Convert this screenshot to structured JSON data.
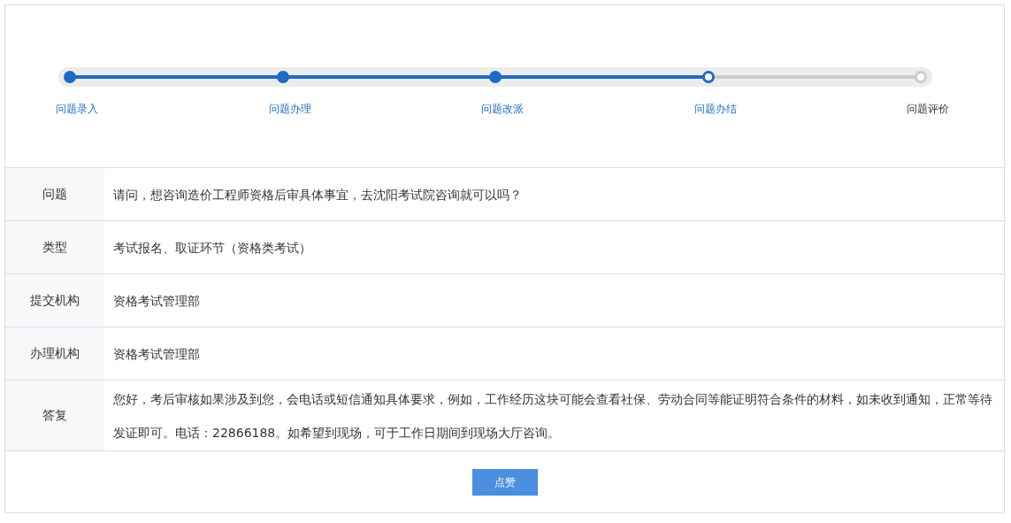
{
  "progress": {
    "level": 0.75,
    "steps": [
      {
        "label": "问题录入",
        "completed": true,
        "current": false
      },
      {
        "label": "问题办理",
        "completed": true,
        "current": false
      },
      {
        "label": "问题改派",
        "completed": true,
        "current": false
      },
      {
        "label": "问题办结",
        "completed": false,
        "current": true
      },
      {
        "label": "问题评价",
        "completed": false,
        "current": false
      }
    ]
  },
  "details": [
    {
      "label": "问题",
      "value": "请问，想咨询造价工程师资格后审具体事宜，去沈阳考试院咨询就可以吗？"
    },
    {
      "label": "类型",
      "value": "考试报名、取证环节（资格类考试）"
    },
    {
      "label": "提交机构",
      "value": "资格考试管理部"
    },
    {
      "label": "办理机构",
      "value": "资格考试管理部"
    },
    {
      "label": "答复",
      "value": "您好，考后审核如果涉及到您，会电话或短信通知具体要求，例如，工作经历这块可能会查看社保、劳动合同等能证明符合条件的材料，如未收到通知，正常等待发证即可。电话：22866188。如希望到现场，可于工作日期间到现场大厅咨询。"
    }
  ],
  "like_button": "点赞"
}
